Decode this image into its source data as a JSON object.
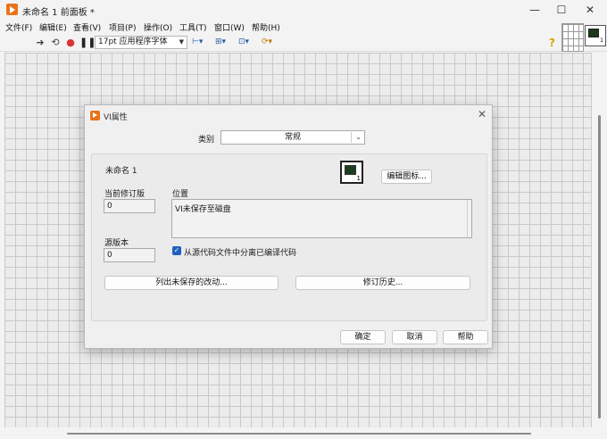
{
  "window": {
    "title": "未命名 1 前面板 *",
    "controls": {
      "minimize": "—",
      "maximize": "☐",
      "close": "✕"
    }
  },
  "menu": [
    "文件(F)",
    "编辑(E)",
    "查看(V)",
    "项目(P)",
    "操作(O)",
    "工具(T)",
    "窗口(W)",
    "帮助(H)"
  ],
  "toolbar": {
    "run_icon": "run-arrow-icon",
    "font_select": "17pt 应用程序字体",
    "help": "?"
  },
  "dialog": {
    "title": "VI属性",
    "close": "✕",
    "category_label": "类别",
    "category_value": "常规",
    "vi_name": "未命名 1",
    "edit_icon_button": "编辑图标...",
    "current_revision_label": "当前修订版",
    "current_revision_value": "0",
    "location_label": "位置",
    "location_value": "VI未保存至磁盘",
    "source_version_label": "源版本",
    "source_version_value": "0",
    "separate_compiled_label": "从源代码文件中分离已编译代码",
    "separate_compiled_checked": true,
    "list_unsaved_button": "列出未保存的改动...",
    "revision_history_button": "修订历史...",
    "ok_button": "确定",
    "cancel_button": "取消",
    "help_button": "帮助"
  },
  "colors": {
    "accent": "#1f5fbf",
    "labview_orange": "#e8731a",
    "canvas_grid": "#c9c9c9"
  }
}
